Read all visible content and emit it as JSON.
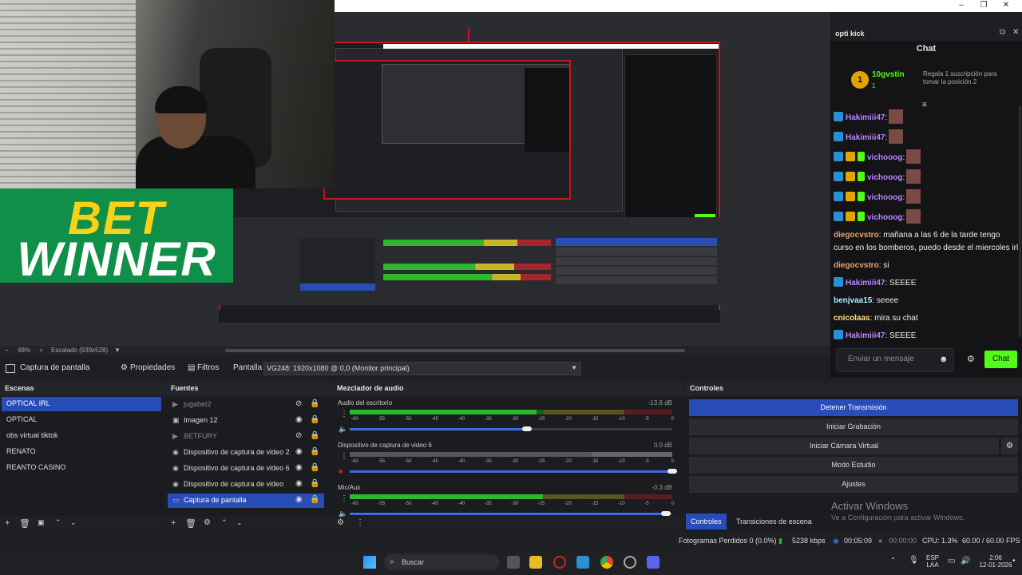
{
  "window": {
    "minimize": "–",
    "maximize": "❐",
    "close": "✕"
  },
  "overlay": {
    "bet": "BET",
    "winner": "WINNER"
  },
  "zoom": {
    "minus": "−",
    "percent": "48%",
    "plus": "+",
    "scaled": "Escalado (939x528)"
  },
  "source_bar": {
    "capture_label": "Captura de pantalla",
    "properties": "Propiedades",
    "filters": "Filtros",
    "screen_label": "Pantalla",
    "screen_value": "VG248: 1920x1080 @ 0,0 (Monitor principal)"
  },
  "chat": {
    "dock_title": "opti kick",
    "title": "Chat",
    "pinned_user": "10gvstin",
    "pinned_count": "1",
    "pinned_text": "Regala 1 suscripción para tomar la posición 2",
    "messages": [
      {
        "user": "Hakimiii47",
        "text": ":",
        "color": "#b886ff",
        "badges": [
          "blue"
        ],
        "emote": true
      },
      {
        "user": "Hakimiii47",
        "text": ":",
        "color": "#b886ff",
        "badges": [
          "blue"
        ],
        "emote": true
      },
      {
        "user": "vichooog",
        "text": ":",
        "color": "#b886ff",
        "badges": [
          "blue",
          "gold",
          "green"
        ],
        "emote": true
      },
      {
        "user": "vichooog",
        "text": ":",
        "color": "#b886ff",
        "badges": [
          "blue",
          "gold",
          "green"
        ],
        "emote": true
      },
      {
        "user": "vichooog",
        "text": ":",
        "color": "#b886ff",
        "badges": [
          "blue",
          "gold",
          "green"
        ],
        "emote": true
      },
      {
        "user": "vichooog",
        "text": ":",
        "color": "#b886ff",
        "badges": [
          "blue",
          "gold",
          "green"
        ],
        "emote": true
      },
      {
        "user": "diegocvstro",
        "text": ": mañana a las 6 de la tarde tengo curso en los bomberos, puedo desde el miercoles irl",
        "color": "#e8a46a",
        "badges": [],
        "emote": false
      },
      {
        "user": "diegocvstro",
        "text": ": si",
        "color": "#e8a46a",
        "badges": [],
        "emote": false
      },
      {
        "user": "Hakimiii47",
        "text": ": SEEEE",
        "color": "#b886ff",
        "badges": [
          "blue"
        ],
        "emote": false
      },
      {
        "user": "benjvaa15",
        "text": ": seeee",
        "color": "#a7f0ff",
        "badges": [],
        "emote": false
      },
      {
        "user": "cnicolaas",
        "text": ": mira su chat",
        "color": "#ffe27a",
        "badges": [],
        "emote": false
      },
      {
        "user": "Hakimiii47",
        "text": ": SEEEE",
        "color": "#b886ff",
        "badges": [
          "blue"
        ],
        "emote": false
      }
    ],
    "input_placeholder": "Enviar un mensaje",
    "send": "Chat"
  },
  "scenes": {
    "title": "Escenas",
    "items": [
      "OPTICAL IRL",
      "OPTICAL",
      "obs virtual tiktok",
      "RENATO",
      "REANTO CASINO"
    ],
    "selected": 0
  },
  "sources": {
    "title": "Fuentes",
    "items": [
      {
        "name": "jugabet2",
        "icon": "play-icon",
        "hidden": true
      },
      {
        "name": "Imagen 12",
        "icon": "image-icon",
        "hidden": false
      },
      {
        "name": "BETFURY",
        "icon": "play-icon",
        "hidden": true
      },
      {
        "name": "Dispositivo de captura de video 2",
        "icon": "camera-icon",
        "hidden": false
      },
      {
        "name": "Dispositivo de captura de video 6",
        "icon": "camera-icon",
        "hidden": false
      },
      {
        "name": "Dispositivo de captura de video",
        "icon": "camera-icon",
        "hidden": false
      },
      {
        "name": "Captura de pantalla",
        "icon": "monitor-icon",
        "hidden": false
      }
    ],
    "selected": 6
  },
  "mixer": {
    "title": "Mezclador de audio",
    "scale": [
      "-60",
      "-55",
      "-50",
      "-45",
      "-40",
      "-35",
      "-30",
      "-25",
      "-20",
      "-15",
      "-10",
      "-5",
      "0"
    ],
    "channels": [
      {
        "name": "Audio del escritorio",
        "db": "-13.6 dB",
        "level": 0.58,
        "volume": 0.55
      },
      {
        "name": "Dispositivo de captura de video 6",
        "db": "0.0 dB",
        "level": 0.0,
        "volume": 1.0
      },
      {
        "name": "Mic/Aux",
        "db": "-0.3 dB",
        "level": 0.6,
        "volume": 0.98
      }
    ]
  },
  "controls": {
    "title": "Controles",
    "buttons": [
      "Detener Transmisión",
      "Iniciar Grabación",
      "Iniciar Cámara Virtual",
      "Modo Estudio",
      "Ajustes"
    ],
    "watermark_title": "Activar Windows",
    "watermark_text": "Ve a Configuración para activar Windows.",
    "tabs": [
      "Controles",
      "Transiciones de escena"
    ]
  },
  "status": {
    "dropped": "Fotogramas Perdidos 0 (0.0%)",
    "bitrate": "5238 kbps",
    "live_time": "00:05:09",
    "rec_time": "00:00:00",
    "cpu": "CPU: 1.3%",
    "fps": "60.00 / 60.00 FPS"
  },
  "taskbar": {
    "search": "Buscar",
    "lang": "ESP",
    "lang2": "LAA",
    "time": "2:06",
    "date": "12-01-2026"
  }
}
